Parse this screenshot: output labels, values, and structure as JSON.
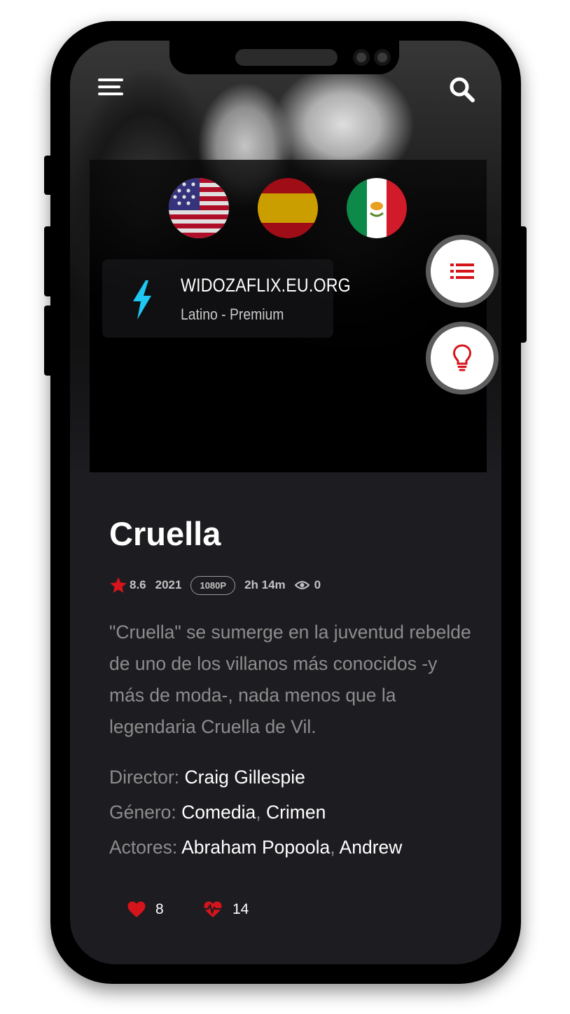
{
  "player": {
    "languages": [
      {
        "name": "English (US) flag"
      },
      {
        "name": "Spanish flag"
      },
      {
        "name": "Mexican flag"
      }
    ],
    "server": {
      "name": "WIDOZAFLIX.EU.ORG",
      "subtitle": "Latino - Premium"
    }
  },
  "movie": {
    "title": "Cruella",
    "rating": "8.6",
    "year": "2021",
    "quality": "1080P",
    "duration": "2h 14m",
    "views": "0",
    "synopsis": "\"Cruella\" se sumerge en la juventud rebelde de uno de los villanos más conocidos -y más de moda-, nada menos que la legendaria Cruella de Vil.",
    "director_label": "Director:",
    "director": "Craig Gillespie",
    "genre_label": "Género:",
    "genres": [
      "Comedia",
      "Crimen"
    ],
    "actors_label": "Actores:",
    "actors": [
      "Abraham Popoola",
      "Andrew"
    ],
    "separator": ","
  },
  "reactions": {
    "likes": "8",
    "favorites": "14"
  },
  "icons": {
    "menu": "hamburger-menu-icon",
    "search": "search-icon",
    "server": "lightning-bolt-icon",
    "episodes": "list-icon",
    "light": "lightbulb-icon",
    "rating": "star-icon",
    "views": "eye-icon",
    "likes": "heart-icon",
    "favorites": "heartbeat-icon"
  },
  "colors": {
    "accent_red": "#d6141c",
    "bolt_cyan": "#1ec8f0",
    "background": "#1d1d21",
    "text_muted": "#8d8d8d"
  }
}
